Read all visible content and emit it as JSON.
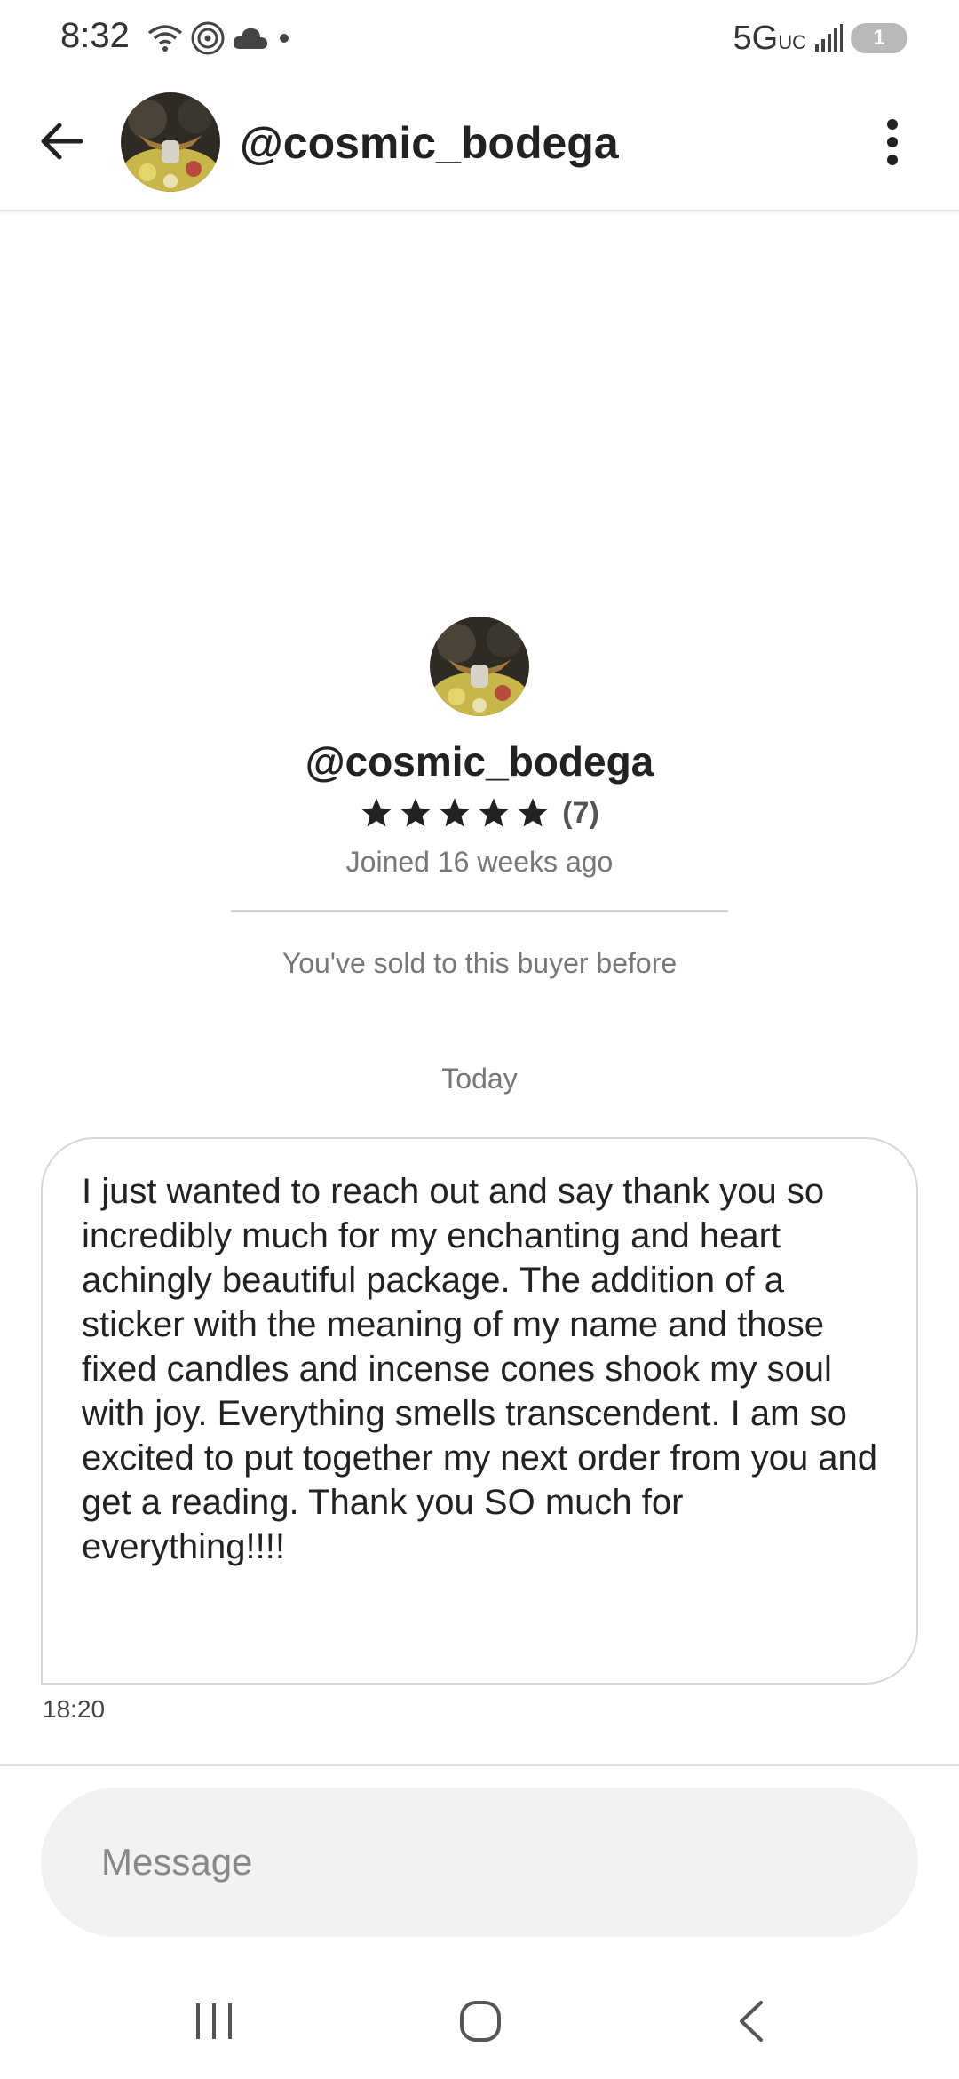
{
  "status_bar": {
    "time": "8:32",
    "network": "5G",
    "network_sub": "UC",
    "battery": "1",
    "icons": [
      "wifi-icon",
      "hotspot-icon",
      "cloud-icon",
      "dot-icon",
      "signal-icon",
      "battery-charging-icon"
    ]
  },
  "header": {
    "back_icon": "arrow-left-icon",
    "username": "@cosmic_bodega",
    "more_icon": "more-vertical-icon"
  },
  "profile": {
    "username": "@cosmic_bodega",
    "rating_stars": 5,
    "rating_count": "(7)",
    "joined": "Joined 16 weeks ago",
    "sold_note": "You've sold to this buyer before"
  },
  "conversation": {
    "date_label": "Today",
    "messages": [
      {
        "text": "I just wanted to reach out and say thank you so incredibly much for my enchanting and heart achingly beautiful package. The addition of a sticker with the meaning of my name and those fixed candles and incense cones shook my soul with joy. Everything smells transcendent. I am so excited to put together my next order from you and get a reading. Thank you SO much for everything!!!!",
        "time": "18:20"
      }
    ]
  },
  "composer": {
    "placeholder": "Message"
  },
  "nav_bar": {
    "icons": [
      "recents-icon",
      "home-icon",
      "back-icon"
    ]
  },
  "colors": {
    "text": "#222222",
    "muted": "#777777",
    "input_bg": "#f2f2f2",
    "border": "#d6d6d6",
    "star": "#222222"
  }
}
